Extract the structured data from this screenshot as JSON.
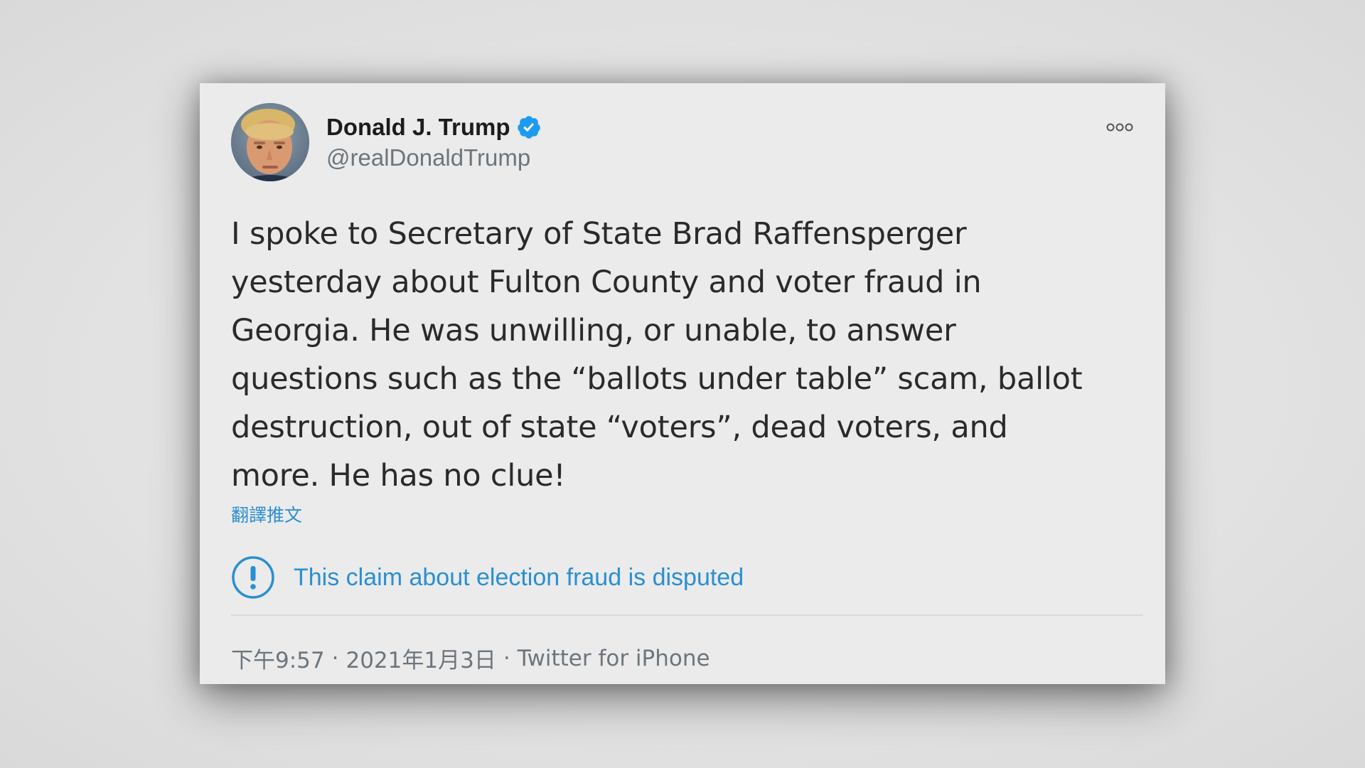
{
  "tweet": {
    "author": {
      "display_name": "Donald J. Trump",
      "handle": "@realDonaldTrump",
      "verified": true,
      "avatar_icon": "profile-photo"
    },
    "more_icon": "more-options-icon",
    "text": "I spoke to Secretary of State Brad Raffensperger\nyesterday about Fulton County and voter fraud in\nGeorgia. He was unwilling, or unable, to answer\nquestions such as the “ballots under table” scam, ballot\ndestruction, out of state “voters”, dead voters, and\nmore. He has no clue!",
    "translate_label": "翻譯推文",
    "notice": {
      "icon": "exclamation-circle-icon",
      "text": "This claim about election fraud is disputed"
    },
    "meta": {
      "time": "下午9:57",
      "separator": "·",
      "date": "2021年1月3日",
      "source": "Twitter for iPhone"
    }
  },
  "colors": {
    "accent_blue": "#2a8fd0",
    "verified_blue": "#1d9bf0",
    "text_dark": "#2a2a2a",
    "text_muted": "#6d757c",
    "card_bg": "#ebebeb"
  }
}
